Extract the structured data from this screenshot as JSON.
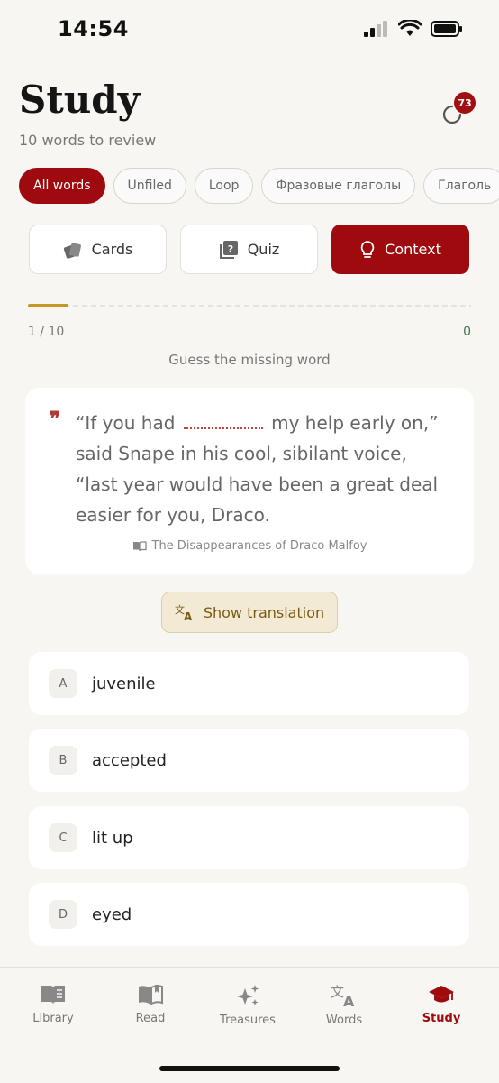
{
  "status": {
    "time": "14:54"
  },
  "header": {
    "title": "Study",
    "subtitle": "10 words to review",
    "badge_count": "73"
  },
  "filters": [
    {
      "label": "All words",
      "active": true
    },
    {
      "label": "Unfiled"
    },
    {
      "label": "Loop"
    },
    {
      "label": "Фразовые глаголы"
    },
    {
      "label": "Глаголь"
    }
  ],
  "modes": {
    "cards": "Cards",
    "quiz": "Quiz",
    "context": "Context",
    "active": "context"
  },
  "progress": {
    "counter": "1 / 10",
    "score": "0",
    "fraction": 0.1
  },
  "instruction": "Guess the missing word",
  "quote": {
    "before": "“If you had",
    "after": "my help early on,” said Snape in his cool, sibilant voice, “last year would have been a great deal easier for you, Draco.",
    "source": "The Disappearances of Draco Malfoy"
  },
  "translation_button": "Show translation",
  "answers": [
    {
      "letter": "A",
      "text": "juvenile"
    },
    {
      "letter": "B",
      "text": "accepted"
    },
    {
      "letter": "C",
      "text": "lit up"
    },
    {
      "letter": "D",
      "text": "eyed"
    }
  ],
  "tabs": [
    {
      "label": "Library",
      "icon": "book-icon"
    },
    {
      "label": "Read",
      "icon": "open-book-icon"
    },
    {
      "label": "Treasures",
      "icon": "sparkles-icon"
    },
    {
      "label": "Words",
      "icon": "translate-icon"
    },
    {
      "label": "Study",
      "icon": "graduation-cap-icon",
      "active": true
    }
  ],
  "colors": {
    "accent": "#9e0a0d",
    "progress": "#c49a25",
    "score": "#3f7a4e"
  }
}
